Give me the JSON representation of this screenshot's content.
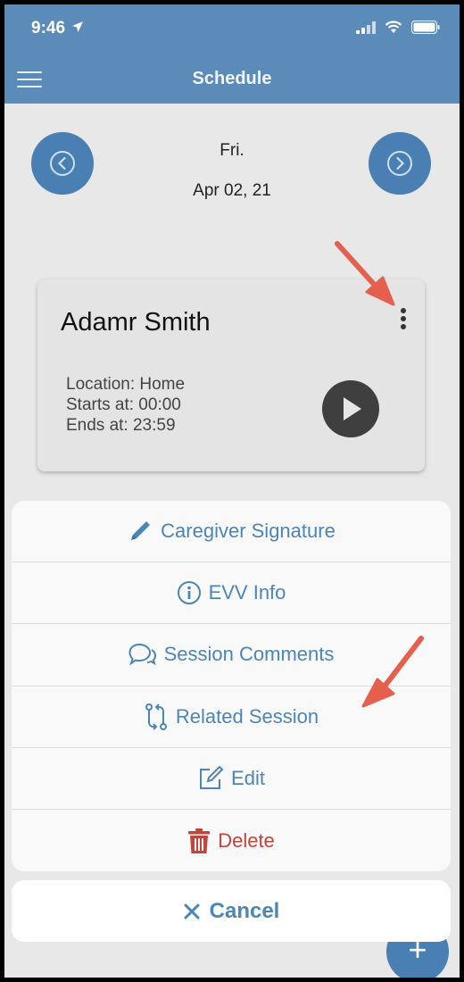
{
  "status_bar": {
    "time": "9:46"
  },
  "header": {
    "title": "Schedule"
  },
  "date_nav": {
    "day": "Fri.",
    "date": "Apr 02, 21"
  },
  "session_card": {
    "name": "Adamr Smith",
    "location": "Location: Home",
    "starts": "Starts at: 00:00",
    "ends": "Ends at: 23:59"
  },
  "action_sheet": {
    "items": [
      {
        "label": "Caregiver Signature",
        "icon": "pencil-icon"
      },
      {
        "label": "EVV Info",
        "icon": "info-icon"
      },
      {
        "label": "Session Comments",
        "icon": "comments-icon"
      },
      {
        "label": "Related Session",
        "icon": "related-icon"
      },
      {
        "label": "Edit",
        "icon": "edit-icon"
      },
      {
        "label": "Delete",
        "icon": "trash-icon"
      }
    ],
    "cancel_label": "Cancel"
  },
  "fab": {
    "label": "+"
  },
  "colors": {
    "header": "#5b8bb8",
    "accent": "#4a86b8",
    "danger": "#c0453c",
    "annotation_arrow": "#e4604d"
  }
}
